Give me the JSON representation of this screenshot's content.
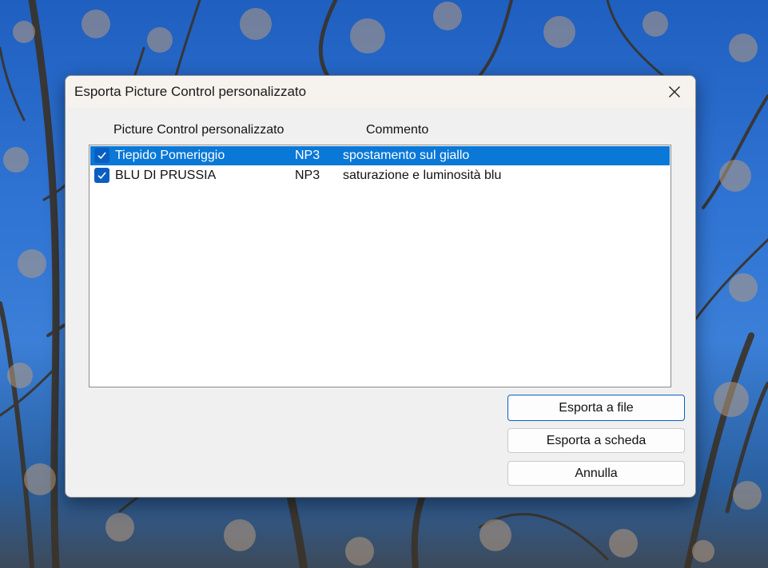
{
  "dialog": {
    "title": "Esporta Picture Control personalizzato",
    "close_icon": "close-icon"
  },
  "columns": {
    "name": "Picture Control personalizzato",
    "comment": "Commento"
  },
  "items": [
    {
      "name": "Tiepido Pomeriggio",
      "format": "NP3",
      "comment": "spostamento sul giallo",
      "checked": true,
      "selected": true
    },
    {
      "name": "BLU DI PRUSSIA",
      "format": "NP3",
      "comment": "saturazione e luminosità blu",
      "checked": true,
      "selected": false
    }
  ],
  "buttons": {
    "export_file": "Esporta a file",
    "export_card": "Esporta a scheda",
    "cancel": "Annulla"
  },
  "colors": {
    "selection": "#0a78d7",
    "checkbox": "#0a5ec2",
    "dialog_bg": "#f0f0f0"
  }
}
